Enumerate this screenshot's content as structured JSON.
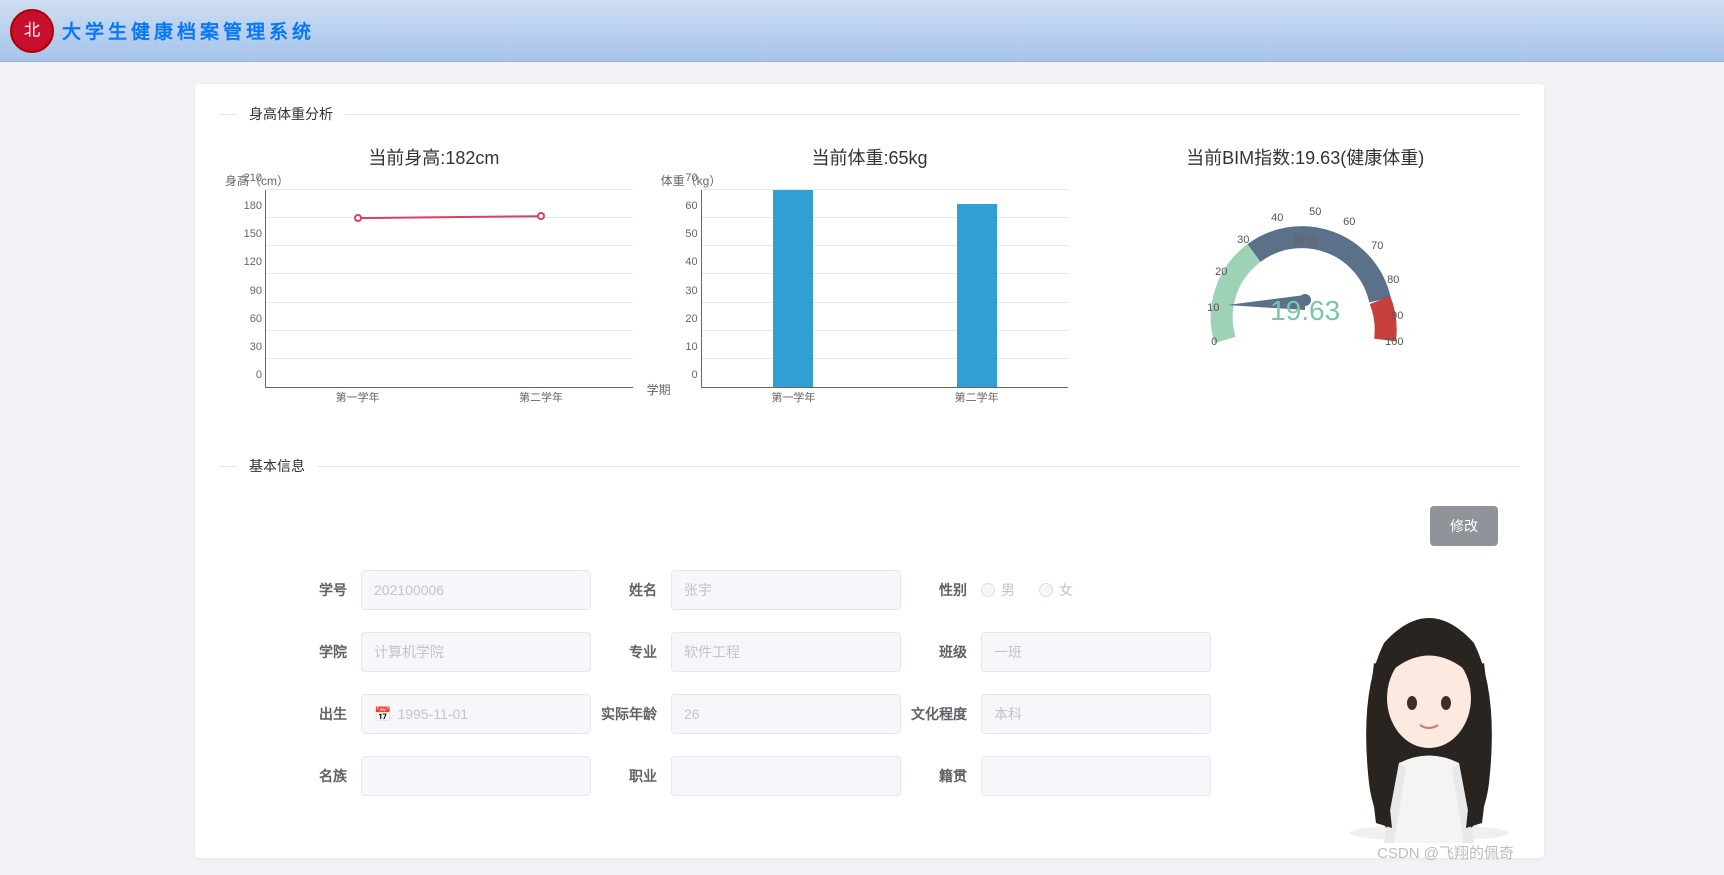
{
  "header": {
    "title": "大学生健康档案管理系统"
  },
  "sections": {
    "analysis": "身高体重分析",
    "basic": "基本信息"
  },
  "charts": {
    "height": {
      "title": "当前身高:182cm",
      "yLabel": "身高（cm）",
      "xLabel": "学期"
    },
    "weight": {
      "title": "当前体重:65kg",
      "yLabel": "体重（kg）"
    },
    "bmi": {
      "title": "当前BIM指数:19.63(健康体重)",
      "name": "数值",
      "value": "19.63"
    }
  },
  "gauge_ticks": [
    "0",
    "10",
    "20",
    "30",
    "40",
    "50",
    "60",
    "70",
    "80",
    "90",
    "100"
  ],
  "form": {
    "edit_btn": "修改",
    "labels": {
      "id": "学号",
      "name": "姓名",
      "sex": "性别",
      "college": "学院",
      "major": "专业",
      "class": "班级",
      "birth": "出生",
      "age": "实际年龄",
      "edu": "文化程度",
      "ethnic": "名族",
      "job": "职业",
      "origin": "籍贯"
    },
    "values": {
      "id": "202100006",
      "name": "张宇",
      "college": "计算机学院",
      "major": "软件工程",
      "class": "一班",
      "birth": "1995-11-01",
      "age": "26",
      "edu": "本科",
      "ethnic": "",
      "job": "",
      "origin": ""
    },
    "sex_options": {
      "male": "男",
      "female": "女"
    }
  },
  "watermark": "CSDN @飞翔的佩奇",
  "chart_data": [
    {
      "type": "line",
      "title": "当前身高:182cm",
      "ylabel": "身高（cm）",
      "xlabel": "学期",
      "categories": [
        "第一学年",
        "第二学年"
      ],
      "values": [
        180,
        182
      ],
      "y_ticks": [
        0,
        30,
        60,
        90,
        120,
        150,
        180,
        210
      ],
      "ylim": [
        0,
        210
      ]
    },
    {
      "type": "bar",
      "title": "当前体重:65kg",
      "ylabel": "体重（kg）",
      "categories": [
        "第一学年",
        "第二学年"
      ],
      "values": [
        70,
        65
      ],
      "y_ticks": [
        0,
        10,
        20,
        30,
        40,
        50,
        60,
        70
      ],
      "ylim": [
        0,
        70
      ]
    },
    {
      "type": "gauge",
      "title": "当前BIM指数:19.63(健康体重)",
      "name": "数值",
      "value": 19.63,
      "min": 0,
      "max": 100,
      "ticks": [
        0,
        10,
        20,
        30,
        40,
        50,
        60,
        70,
        80,
        90,
        100
      ],
      "segments": [
        {
          "from": 0,
          "to": 30,
          "color": "#9ed2b6"
        },
        {
          "from": 30,
          "to": 80,
          "color": "#5a7189"
        },
        {
          "from": 80,
          "to": 100,
          "color": "#c6403e"
        }
      ]
    }
  ]
}
